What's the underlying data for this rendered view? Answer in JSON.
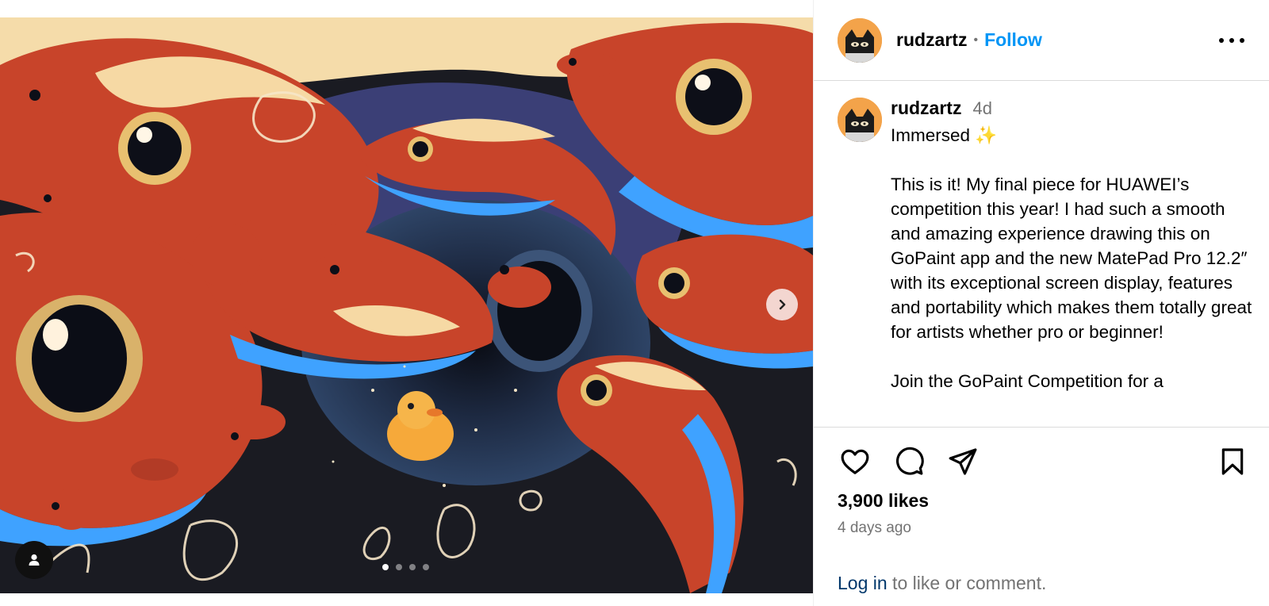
{
  "post": {
    "username": "rudzartz",
    "follow_label": "Follow",
    "separator": "•",
    "caption_time": "4d",
    "caption_text": "Immersed ✨\n\nThis is it! My final piece for HUAWEI’s competition this year! I had such a smooth and amazing experience drawing this on GoPaint app and the new MatePad Pro 12.2″ with its exceptional screen display, features and portability which makes them totally great for artists whether pro or beginner!\n\nJoin the GoPaint Competition for a",
    "likes": "3,900 likes",
    "posted_ago": "4 days ago"
  },
  "footer": {
    "login_link": "Log in",
    "login_rest": " to like or comment."
  },
  "carousel": {
    "total_slides": 4,
    "active_slide": 1
  },
  "icons": {
    "next": "chevron-right-icon",
    "tags": "user-icon",
    "more": "more-options-icon",
    "like": "heart-icon",
    "comment": "comment-icon",
    "share": "send-icon",
    "save": "bookmark-icon"
  },
  "colors": {
    "accent": "#0095f6",
    "link": "#00376b",
    "muted": "#737373",
    "art_background": "#1a1b22",
    "fish": "#c8442a",
    "fish_highlight": "#f6d9a4",
    "glow": "#3fa2ff"
  }
}
